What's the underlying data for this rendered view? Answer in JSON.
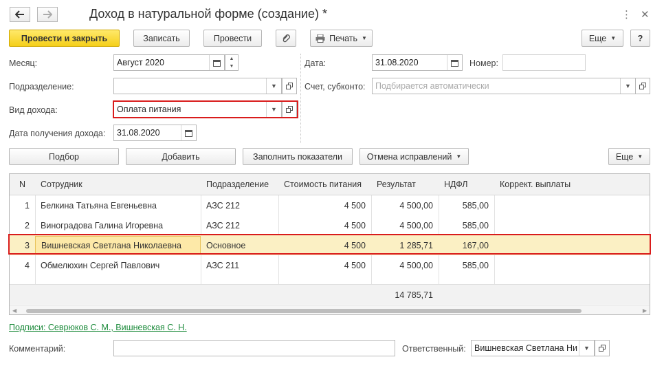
{
  "window": {
    "title": "Доход в натуральной форме (создание) *",
    "more_glyph": "⋮",
    "close_glyph": "✕"
  },
  "toolbar": {
    "post_close": "Провести и закрыть",
    "save": "Записать",
    "post": "Провести",
    "print": "Печать",
    "more": "Еще",
    "help": "?"
  },
  "form": {
    "month_label": "Месяц:",
    "month_value": "Август 2020",
    "subdivision_label": "Подразделение:",
    "subdivision_value": "",
    "income_type_label": "Вид дохода:",
    "income_type_value": "Оплата питания",
    "income_date_label": "Дата получения дохода:",
    "income_date_value": "31.08.2020",
    "date_label": "Дата:",
    "date_value": "31.08.2020",
    "number_label": "Номер:",
    "number_value": "",
    "account_label": "Счет, субконто:",
    "account_placeholder": "Подбирается автоматически"
  },
  "table_toolbar": {
    "pick": "Подбор",
    "add": "Добавить",
    "fill": "Заполнить показатели",
    "cancel_corrections": "Отмена исправлений",
    "more": "Еще"
  },
  "table": {
    "columns": [
      "N",
      "Сотрудник",
      "Подразделение",
      "Стоимость питания",
      "Результат",
      "НДФЛ",
      "Коррект. выплаты"
    ],
    "rows": [
      {
        "n": "1",
        "employee": "Белкина Татьяна Евгеньевна",
        "subdivision": "АЗС 212",
        "cost": "4 500",
        "result": "4 500,00",
        "ndfl": "585,00",
        "corr": ""
      },
      {
        "n": "2",
        "employee": "Виноградова Галина Игоревна",
        "subdivision": "АЗС 212",
        "cost": "4 500",
        "result": "4 500,00",
        "ndfl": "585,00",
        "corr": ""
      },
      {
        "n": "3",
        "employee": "Вишневская Светлана Николаевна",
        "subdivision": "Основное",
        "cost": "4 500",
        "result": "1 285,71",
        "ndfl": "167,00",
        "corr": ""
      },
      {
        "n": "4",
        "employee": "Обмелюхин Сергей Павлович",
        "subdivision": "АЗС 211",
        "cost": "4 500",
        "result": "4 500,00",
        "ndfl": "585,00",
        "corr": ""
      }
    ],
    "selected_row": 3,
    "footer_result_total": "14 785,71"
  },
  "bottom": {
    "signatures_link": "Подписи: Севрюков С. М., Вишневская С. Н.",
    "comment_label": "Комментарий:",
    "comment_value": "",
    "responsible_label": "Ответственный:",
    "responsible_value": "Вишневская Светлана Ни"
  },
  "colors": {
    "primary_button": "#f5cf1a",
    "highlight_frame": "#d91c1c",
    "selected_row": "#fbf0c4",
    "link": "#1b8a3a"
  },
  "icons": [
    "arrow-left-icon",
    "arrow-right-icon",
    "paperclip-icon",
    "printer-icon",
    "calendar-icon",
    "open-form-icon",
    "dropdown-arrow-icon"
  ]
}
